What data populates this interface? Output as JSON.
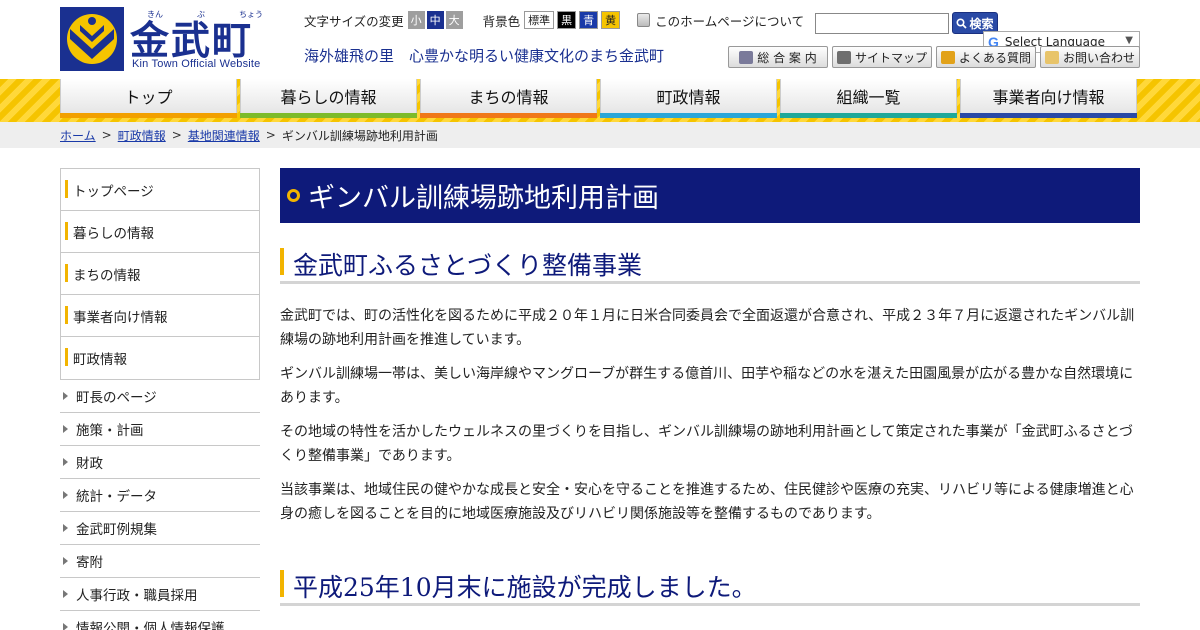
{
  "header": {
    "logo": {
      "name": "金武町",
      "ruby": [
        "きん",
        "ぶ",
        "ちょう"
      ],
      "english": "Kin Town Official Website"
    },
    "font_size": {
      "label": "文字サイズの変更",
      "options": [
        {
          "label": "小",
          "color": "#9e9e9e"
        },
        {
          "label": "中",
          "color": "#1a3090"
        },
        {
          "label": "大",
          "color": "#9e9e9e"
        }
      ]
    },
    "background": {
      "label": "背景色",
      "options": [
        {
          "label": "標準",
          "bg": "#ffffff",
          "fg": "#222222"
        },
        {
          "label": "黒",
          "bg": "#000000",
          "fg": "#ffffff"
        },
        {
          "label": "青",
          "bg": "#1a3aa8",
          "fg": "#ffffff"
        },
        {
          "label": "黄",
          "bg": "#f5c400",
          "fg": "#222222"
        }
      ]
    },
    "about_label": "このホームページについて",
    "search": {
      "placeholder": "",
      "button_label": "検索"
    },
    "language": {
      "label": "Select Language"
    },
    "tagline": "海外雄飛の里　心豊かな明るい健康文化のまち金武町",
    "utility_links": [
      {
        "label": "総 合 案 内",
        "icon": "home-icon"
      },
      {
        "label": "サイトマップ",
        "icon": "sitemap-icon"
      },
      {
        "label": "よくある質問",
        "icon": "faq-icon"
      },
      {
        "label": "お問い合わせ",
        "icon": "mail-icon"
      }
    ]
  },
  "nav": [
    {
      "label": "トップ",
      "color": "#f2a000"
    },
    {
      "label": "暮らしの情報",
      "color": "#7dbb2a"
    },
    {
      "label": "まちの情報",
      "color": "#f07818"
    },
    {
      "label": "町政情報",
      "color": "#2aa6d8"
    },
    {
      "label": "組織一覧",
      "color": "#1fa89a"
    },
    {
      "label": "事業者向け情報",
      "color": "#2a4aa6"
    }
  ],
  "breadcrumb": [
    {
      "label": "ホーム",
      "link": true
    },
    {
      "label": "町政情報",
      "link": true
    },
    {
      "label": "基地関連情報",
      "link": true
    },
    {
      "label": "ギンバル訓練場跡地利用計画",
      "link": false
    }
  ],
  "sidebar": {
    "main": [
      "トップページ",
      "暮らしの情報",
      "まちの情報",
      "事業者向け情報",
      "町政情報"
    ],
    "sub": [
      "町長のページ",
      "施策・計画",
      "財政",
      "統計・データ",
      "金武町例規集",
      "寄附",
      "人事行政・職員採用",
      "情報公開・個人情報保護"
    ]
  },
  "main": {
    "page_title": "ギンバル訓練場跡地利用計画",
    "section1_heading": "金武町ふるさとづくり整備事業",
    "paragraphs": [
      "金武町では、町の活性化を図るために平成２０年１月に日米合同委員会で全面返還が合意され、平成２３年７月に返還されたギンバル訓練場の跡地利用計画を推進しています。",
      "ギンバル訓練場一帯は、美しい海岸線やマングローブが群生する億首川、田芋や稲などの水を湛えた田園風景が広がる豊かな自然環境にあります。",
      "その地域の特性を活かしたウェルネスの里づくりを目指し、ギンバル訓練場の跡地利用計画として策定された事業が「金武町ふるさとづくり整備事業」であります。",
      "当該事業は、地域住民の健やかな成長と安全・安心を守ることを推進するため、住民健診や医療の充実、リハビリ等による健康増進と心身の癒しを図ることを目的に地域医療施設及びリハビリ関係施設等を整備するものであります。"
    ],
    "section2_heading": "平成25年10月末に施設が完成しました。"
  }
}
